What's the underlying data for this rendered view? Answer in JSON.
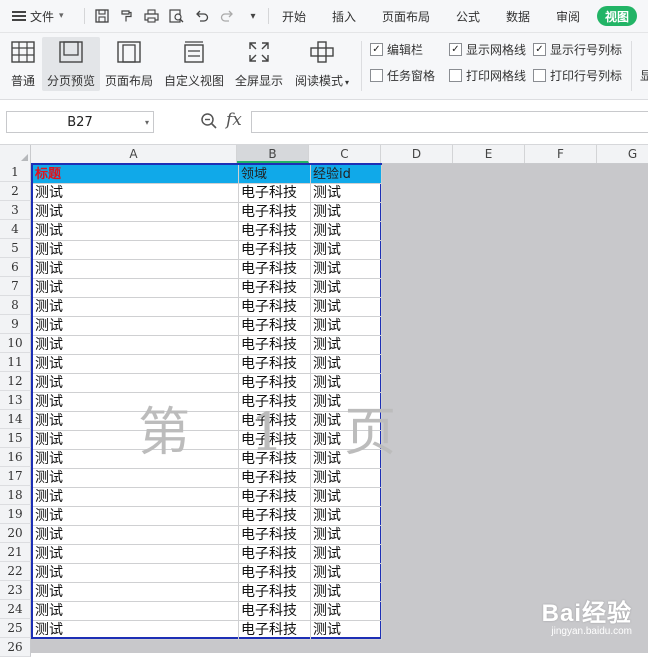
{
  "menubar": {
    "file_label": "文件",
    "tabs": [
      "开始",
      "插入",
      "页面布局",
      "公式",
      "数据",
      "审阅",
      "视图"
    ],
    "active_tab": "视图"
  },
  "ribbon": {
    "buttons": [
      {
        "label": "普通"
      },
      {
        "label": "分页预览"
      },
      {
        "label": "页面布局"
      },
      {
        "label": "自定义视图"
      },
      {
        "label": "全屏显示"
      },
      {
        "label": "阅读模式"
      }
    ],
    "checkboxes": [
      {
        "label": "编辑栏",
        "checked": true
      },
      {
        "label": "显示网格线",
        "checked": true
      },
      {
        "label": "显示行号列标",
        "checked": true
      },
      {
        "label": "任务窗格",
        "checked": false
      },
      {
        "label": "打印网格线",
        "checked": false
      },
      {
        "label": "打印行号列标",
        "checked": false
      }
    ],
    "overflow_label": "显"
  },
  "formula_bar": {
    "cell_ref": "B27",
    "fx_label": "fx",
    "value": ""
  },
  "sheet": {
    "columns": [
      "A",
      "B",
      "C",
      "D",
      "E",
      "F",
      "G"
    ],
    "selected_column": "B",
    "header_row": [
      "标题",
      "领域",
      "经验id"
    ],
    "rows": [
      [
        "测试",
        "电子科技",
        "测试"
      ],
      [
        "测试",
        "电子科技",
        "测试"
      ],
      [
        "测试",
        "电子科技",
        "测试"
      ],
      [
        "测试",
        "电子科技",
        "测试"
      ],
      [
        "测试",
        "电子科技",
        "测试"
      ],
      [
        "测试",
        "电子科技",
        "测试"
      ],
      [
        "测试",
        "电子科技",
        "测试"
      ],
      [
        "测试",
        "电子科技",
        "测试"
      ],
      [
        "测试",
        "电子科技",
        "测试"
      ],
      [
        "测试",
        "电子科技",
        "测试"
      ],
      [
        "测试",
        "电子科技",
        "测试"
      ],
      [
        "测试",
        "电子科技",
        "测试"
      ],
      [
        "测试",
        "电子科技",
        "测试"
      ],
      [
        "测试",
        "电子科技",
        "测试"
      ],
      [
        "测试",
        "电子科技",
        "测试"
      ],
      [
        "测试",
        "电子科技",
        "测试"
      ],
      [
        "测试",
        "电子科技",
        "测试"
      ],
      [
        "测试",
        "电子科技",
        "测试"
      ],
      [
        "测试",
        "电子科技",
        "测试"
      ],
      [
        "测试",
        "电子科技",
        "测试"
      ],
      [
        "测试",
        "电子科技",
        "测试"
      ],
      [
        "测试",
        "电子科技",
        "测试"
      ],
      [
        "测试",
        "电子科技",
        "测试"
      ],
      [
        "测试",
        "电子科技",
        "测试"
      ]
    ],
    "row_numbers": [
      "1",
      "2",
      "3",
      "4",
      "5",
      "6",
      "7",
      "8",
      "9",
      "10",
      "11",
      "12",
      "13",
      "14",
      "15",
      "16",
      "17",
      "18",
      "19",
      "20",
      "21",
      "22",
      "23",
      "24",
      "25",
      "26"
    ],
    "page_watermark": "第 1 页",
    "colors": {
      "header_fill": "#10a9e9",
      "title_text": "#e0121c",
      "page_border": "#1d2fb5",
      "accent": "#22b466"
    }
  },
  "brand": {
    "logo_text": "Bai经验",
    "url_text": "jingyan.baidu.com"
  }
}
